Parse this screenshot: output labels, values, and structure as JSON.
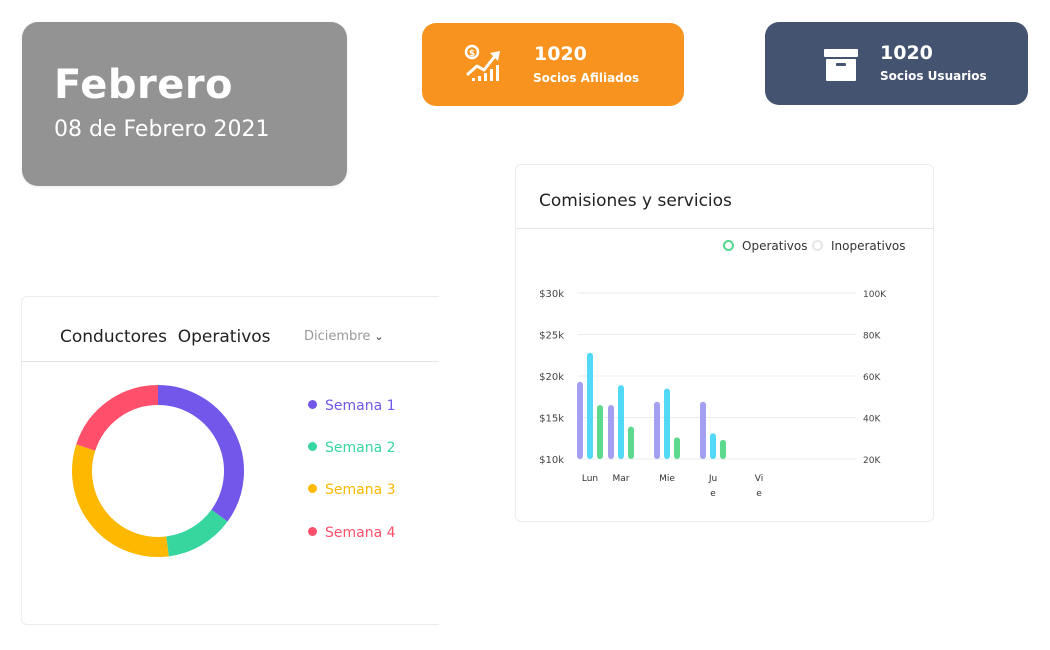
{
  "date_card": {
    "month": "Febrero",
    "date": "08 de Febrero 2021"
  },
  "stats": [
    {
      "value": "1020",
      "label": "Socios Afiliados",
      "icon": "growth-chart-icon",
      "color": "#f7931e"
    },
    {
      "value": "1020",
      "label": "Socios Usuarios",
      "icon": "archive-box-icon",
      "color": "#44536f"
    }
  ],
  "drivers_panel": {
    "title": "Conductores  Operativos",
    "period": "Diciembre",
    "legend": [
      {
        "label": "Semana 1",
        "color": "#7356ea"
      },
      {
        "label": "Semana 2",
        "color": "#36d69e"
      },
      {
        "label": "Semana 3",
        "color": "#ffb800"
      },
      {
        "label": "Semana 4",
        "color": "#ff4f6a"
      }
    ]
  },
  "commissions_panel": {
    "title": "Comisiones y servicios",
    "legend": [
      {
        "label": "Operativos",
        "color": "#54d68d"
      },
      {
        "label": "Inoperativos",
        "color": "#e6e6e6"
      }
    ]
  },
  "chart_data": [
    {
      "type": "pie",
      "title": "Conductores  Operativos",
      "categories": [
        "Semana 1",
        "Semana 2",
        "Semana 3",
        "Semana 4"
      ],
      "values": [
        35,
        13,
        32,
        20
      ],
      "colors": [
        "#7356ea",
        "#36d69e",
        "#ffb800",
        "#ff4f6a"
      ]
    },
    {
      "type": "bar",
      "title": "Comisiones y servicios",
      "categories": [
        "Lun",
        "Mar",
        "Mie",
        "Ju\ne",
        "Vi\ne"
      ],
      "series": [
        {
          "values": [
            19.3,
            16.5,
            16.9,
            16.9,
            null
          ],
          "color": "#a39ff1"
        },
        {
          "values": [
            22.8,
            18.9,
            18.5,
            13.1,
            null
          ],
          "color": "#52d9f7"
        },
        {
          "values": [
            16.5,
            13.9,
            12.6,
            12.3,
            null
          ],
          "color": "#5dd98e"
        }
      ],
      "y_left": {
        "ticks": [
          "$10k",
          "$15k",
          "$20k",
          "$25k",
          "$30k"
        ],
        "range": [
          10,
          30
        ]
      },
      "y_right": {
        "ticks": [
          "20K",
          "40K",
          "60K",
          "80K",
          "100K"
        ],
        "range": [
          20,
          100
        ]
      },
      "grid": true
    }
  ]
}
